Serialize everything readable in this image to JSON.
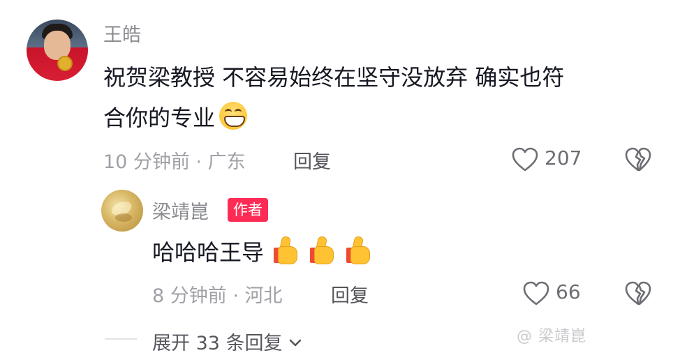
{
  "comment": {
    "username": "王皓",
    "line1": "祝贺梁教授 不容易始终在坚守没放弃 确实也符",
    "line2": "合你的专业",
    "emoji": "grin-emoji",
    "time_location": "10 分钟前 · 广东",
    "reply_label": "回复",
    "like_count": "207"
  },
  "reply": {
    "username": "梁靖崑",
    "badge": "作者",
    "text": "哈哈哈王导",
    "emoji": "thumbs-up-emoji",
    "time_location": "8 分钟前 · 河北",
    "reply_label": "回复",
    "like_count": "66"
  },
  "expand_label": "展开 33 条回复",
  "watermark": "@ 梁靖崑"
}
